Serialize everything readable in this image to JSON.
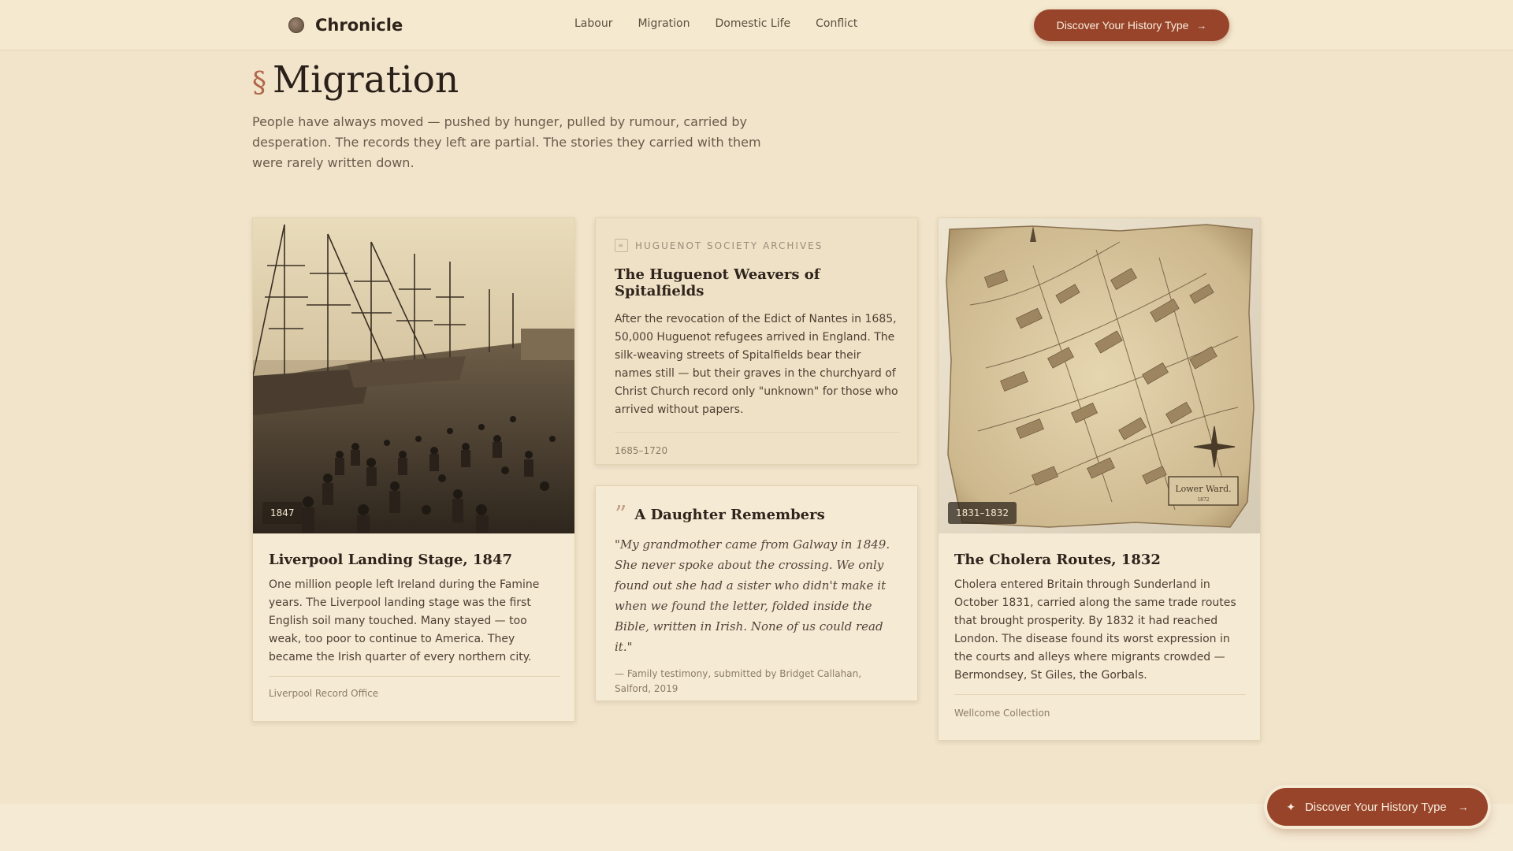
{
  "header": {
    "logo": "Chronicle",
    "nav": [
      "Labour",
      "Migration",
      "Domestic Life",
      "Conflict"
    ],
    "cta": "Discover Your History Type"
  },
  "section": {
    "mark": "§",
    "title": "Migration",
    "intro": "People have always moved — pushed by hunger, pulled by rumour, carried by desperation. The records they left are partial. The stories they carried with them were rarely written down."
  },
  "cards": {
    "liverpool": {
      "date": "1847",
      "title": "Liverpool Landing Stage, 1847",
      "body": "One million people left Ireland during the Famine years. The Liverpool landing stage was the first English soil many touched. Many stayed — too weak, too poor to continue to America. They became the Irish quarter of every northern city.",
      "source": "Liverpool Record Office"
    },
    "huguenot": {
      "archive": "HUGUENOT SOCIETY ARCHIVES",
      "title": "The Huguenot Weavers of Spitalfields",
      "body": "After the revocation of the Edict of Nantes in 1685, 50,000 Huguenot refugees arrived in England. The silk-weaving streets of Spitalfields bear their names still — but their graves in the churchyard of Christ Church record only \"unknown\" for those who arrived without papers.",
      "dates": "1685–1720"
    },
    "daughter": {
      "title": "A Daughter Remembers",
      "quote": "\"My grandmother came from Galway in 1849. She never spoke about the crossing. We only found out she had a sister who didn't make it when we found the letter, folded inside the Bible, written in Irish. None of us could read it.\"",
      "attribution": "— Family testimony, submitted by Bridget Callahan, Salford, 2019"
    },
    "cholera": {
      "date": "1831–1832",
      "title": "The Cholera Routes, 1832",
      "body": "Cholera entered Britain through Sunderland in October 1831, carried along the same trade routes that brought prosperity. By 1832 it had reached London. The disease found its worst expression in the courts and alleys where migrants crowded — Bermondsey, St Giles, the Gorbals.",
      "source": "Wellcome Collection",
      "map_cartouche_line1": "Lower Ward.",
      "map_cartouche_line2": "1872"
    }
  },
  "float_cta": "Discover Your History Type",
  "colors": {
    "accent": "#97442a",
    "background": "#f1e4cb",
    "card": "#f5ead4"
  }
}
